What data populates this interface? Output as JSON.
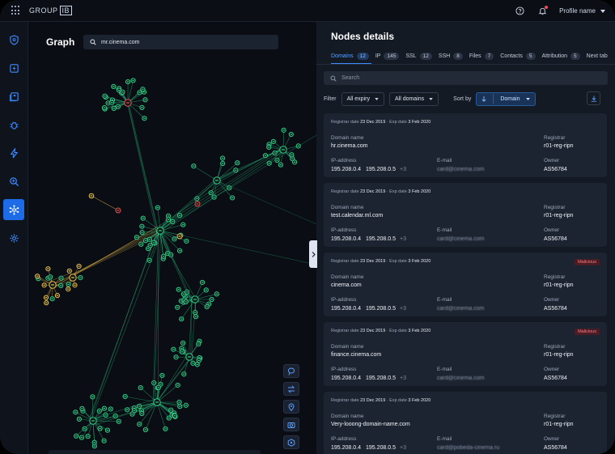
{
  "app": {
    "brand_left": "GROUP",
    "brand_right": "IB",
    "profile_label": "Profile name"
  },
  "graph": {
    "title": "Graph",
    "search_value": "mr.cinema.com"
  },
  "details": {
    "title": "Nodes details",
    "tabs": [
      {
        "label": "Domains",
        "count": "12",
        "active": true
      },
      {
        "label": "IP",
        "count": "145"
      },
      {
        "label": "SSL",
        "count": "12"
      },
      {
        "label": "SSH",
        "count": "8"
      },
      {
        "label": "Files",
        "count": "7"
      },
      {
        "label": "Contacts",
        "count": "5"
      },
      {
        "label": "Attribution",
        "count": "5"
      },
      {
        "label": "Next tab",
        "count": ""
      }
    ],
    "search_placeholder": "Search",
    "filter_label": "Filter",
    "filter_expiry": "All expiry",
    "filter_domains": "All domains",
    "sort_label": "Sort by",
    "sort_value": "Domain",
    "field_labels": {
      "registrar_date": "Registrar date",
      "exp_date": "Exp date",
      "domain_name": "Domain name",
      "registrar": "Registrar",
      "ip_address": "IP-address",
      "email": "E-mail",
      "owner": "Owner"
    },
    "cards": [
      {
        "registrar_date": "23 Dec 2019",
        "exp_date": "3 Feb 2020",
        "badge": "",
        "domain": "hr.cinema.com",
        "registrar": "r01-reg-ripn",
        "ip1": "195.208.0.4",
        "ip2": "195.208.0.5",
        "ip_more": "+3",
        "email": "card@cinema.com",
        "owner": "AS56784"
      },
      {
        "registrar_date": "23 Dec 2019",
        "exp_date": "3 Feb 2020",
        "badge": "",
        "domain": "test.calendar.ml.com",
        "registrar": "r01-reg-ripn",
        "ip1": "195.208.0.4",
        "ip2": "195.208.0.5",
        "ip_more": "+3",
        "email": "card@cinema.com",
        "owner": "AS56784"
      },
      {
        "registrar_date": "23 Dec 2019",
        "exp_date": "3 Feb 2020",
        "badge": "Malicious",
        "domain": "cinema.com",
        "registrar": "r01-reg-ripn",
        "ip1": "195.208.0.4",
        "ip2": "195.208.0.5",
        "ip_more": "+3",
        "email": "card@cinema.com",
        "owner": "AS56784"
      },
      {
        "registrar_date": "23 Dec 2019",
        "exp_date": "3 Feb 2020",
        "badge": "Malicious",
        "domain": "finance.cinema.com",
        "registrar": "r01-reg-ripn",
        "ip1": "195.208.0.4",
        "ip2": "195.208.0.5",
        "ip_more": "+3",
        "email": "card@cinema.com",
        "owner": "AS56784"
      },
      {
        "registrar_date": "23 Dec 2019",
        "exp_date": "3 Feb 2020",
        "badge": "",
        "domain": "Very-looong-domain-name.com",
        "registrar": "r01-reg-ripn",
        "ip1": "195.208.0.4",
        "ip2": "195.208.0.5",
        "ip_more": "+3",
        "email": "card@pobeda-cinema.ru",
        "owner": "AS56784"
      }
    ]
  },
  "colors": {
    "accent": "#1e6be8",
    "node": "#2fd08a",
    "warning": "#f2c14b",
    "danger": "#f04b55"
  }
}
